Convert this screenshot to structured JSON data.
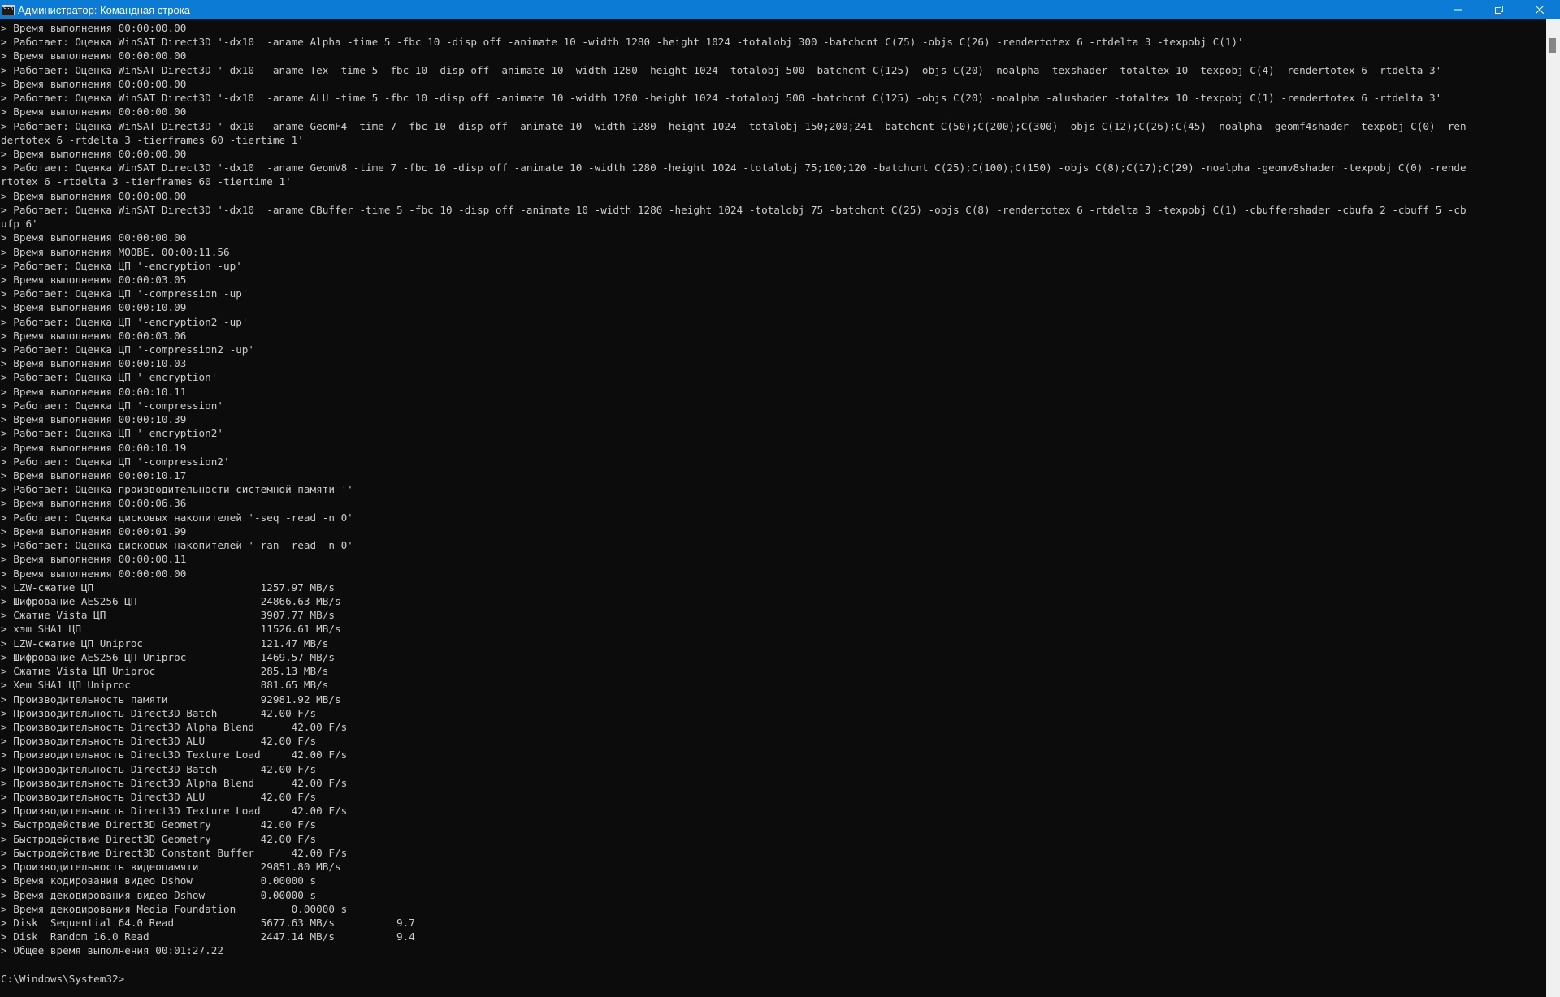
{
  "window": {
    "title": "Администратор: Командная строка",
    "icon": "cmd-icon",
    "controls": {
      "minimize_icon": "minimize-icon",
      "restore_icon": "restore-icon",
      "close_icon": "close-icon"
    },
    "colors": {
      "titlebar": "#0c7bd6",
      "console_bg": "#0c0c0c",
      "console_text": "#cccccc"
    }
  },
  "console": {
    "lines": [
      "> Время выполнения 00:00:00.00",
      "> Работает: Оценка WinSAT Direct3D '-dx10  -aname Alpha -time 5 -fbc 10 -disp off -animate 10 -width 1280 -height 1024 -totalobj 300 -batchcnt C(75) -objs C(26) -rendertotex 6 -rtdelta 3 -texpobj C(1)'",
      "> Время выполнения 00:00:00.00",
      "> Работает: Оценка WinSAT Direct3D '-dx10  -aname Tex -time 5 -fbc 10 -disp off -animate 10 -width 1280 -height 1024 -totalobj 500 -batchcnt C(125) -objs C(20) -noalpha -texshader -totaltex 10 -texpobj C(4) -rendertotex 6 -rtdelta 3'",
      "> Время выполнения 00:00:00.00",
      "> Работает: Оценка WinSAT Direct3D '-dx10  -aname ALU -time 5 -fbc 10 -disp off -animate 10 -width 1280 -height 1024 -totalobj 500 -batchcnt C(125) -objs C(20) -noalpha -alushader -totaltex 10 -texpobj C(1) -rendertotex 6 -rtdelta 3'",
      "> Время выполнения 00:00:00.00",
      "> Работает: Оценка WinSAT Direct3D '-dx10  -aname GeomF4 -time 7 -fbc 10 -disp off -animate 10 -width 1280 -height 1024 -totalobj 150;200;241 -batchcnt C(50);C(200);C(300) -objs C(12);C(26);C(45) -noalpha -geomf4shader -texpobj C(0) -ren",
      "dertotex 6 -rtdelta 3 -tierframes 60 -tiertime 1'",
      "> Время выполнения 00:00:00.00",
      "> Работает: Оценка WinSAT Direct3D '-dx10  -aname GeomV8 -time 7 -fbc 10 -disp off -animate 10 -width 1280 -height 1024 -totalobj 75;100;120 -batchcnt C(25);C(100);C(150) -objs C(8);C(17);C(29) -noalpha -geomv8shader -texpobj C(0) -rende",
      "rtotex 6 -rtdelta 3 -tierframes 60 -tiertime 1'",
      "> Время выполнения 00:00:00.00",
      "> Работает: Оценка WinSAT Direct3D '-dx10  -aname CBuffer -time 5 -fbc 10 -disp off -animate 10 -width 1280 -height 1024 -totalobj 75 -batchcnt C(25) -objs C(8) -rendertotex 6 -rtdelta 3 -texpobj C(1) -cbuffershader -cbufa 2 -cbuff 5 -cb",
      "ufp 6'",
      "> Время выполнения 00:00:00.00",
      "> Время выполнения MOOBE. 00:00:11.56",
      "> Работает: Оценка ЦП '-encryption -up'",
      "> Время выполнения 00:00:03.05",
      "> Работает: Оценка ЦП '-compression -up'",
      "> Время выполнения 00:00:10.09",
      "> Работает: Оценка ЦП '-encryption2 -up'",
      "> Время выполнения 00:00:03.06",
      "> Работает: Оценка ЦП '-compression2 -up'",
      "> Время выполнения 00:00:10.03",
      "> Работает: Оценка ЦП '-encryption'",
      "> Время выполнения 00:00:10.11",
      "> Работает: Оценка ЦП '-compression'",
      "> Время выполнения 00:00:10.39",
      "> Работает: Оценка ЦП '-encryption2'",
      "> Время выполнения 00:00:10.19",
      "> Работает: Оценка ЦП '-compression2'",
      "> Время выполнения 00:00:10.17",
      "> Работает: Оценка производительности системной памяти ''",
      "> Время выполнения 00:00:06.36",
      "> Работает: Оценка дисковых накопителей '-seq -read -n 0'",
      "> Время выполнения 00:00:01.99",
      "> Работает: Оценка дисковых накопителей '-ran -read -n 0'",
      "> Время выполнения 00:00:00.11",
      "> Время выполнения 00:00:00.00",
      "> LZW-сжатие ЦП                           1257.97 MB/s",
      "> Шифрование AES256 ЦП                    24866.63 MB/s",
      "> Сжатие Vista ЦП                         3907.77 MB/s",
      "> хэш SHA1 ЦП                             11526.61 MB/s",
      "> LZW-сжатие ЦП Uniproc                   121.47 MB/s",
      "> Шифрование AES256 ЦП Uniproc            1469.57 MB/s",
      "> Сжатие Vista ЦП Uniproc                 285.13 MB/s",
      "> Хеш SHA1 ЦП Uniproc                     881.65 MB/s",
      "> Производительность памяти               92981.92 MB/s",
      "> Производительность Direct3D Batch       42.00 F/s",
      "> Производительность Direct3D Alpha Blend      42.00 F/s",
      "> Производительность Direct3D ALU         42.00 F/s",
      "> Производительность Direct3D Texture Load     42.00 F/s",
      "> Производительность Direct3D Batch       42.00 F/s",
      "> Производительность Direct3D Alpha Blend      42.00 F/s",
      "> Производительность Direct3D ALU         42.00 F/s",
      "> Производительность Direct3D Texture Load     42.00 F/s",
      "> Быстродействие Direct3D Geometry        42.00 F/s",
      "> Быстродействие Direct3D Geometry        42.00 F/s",
      "> Быстродействие Direct3D Constant Buffer      42.00 F/s",
      "> Производительность видеопамяти          29851.80 MB/s",
      "> Время кодирования видео Dshow           0.00000 s",
      "> Время декодирования видео Dshow         0.00000 s",
      "> Время декодирования Media Foundation         0.00000 s",
      "> Disk  Sequential 64.0 Read              5677.63 MB/s          9.7",
      "> Disk  Random 16.0 Read                  2447.14 MB/s          9.4",
      "> Общее время выполнения 00:01:27.22",
      "",
      "C:\\Windows\\System32>"
    ]
  }
}
